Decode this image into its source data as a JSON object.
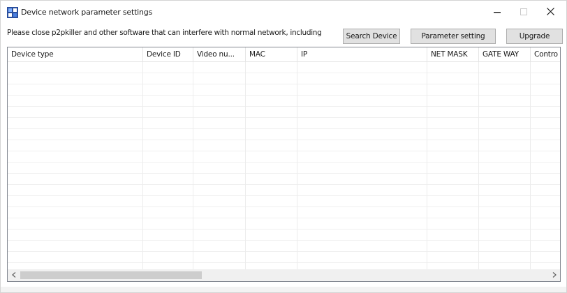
{
  "window": {
    "title": "Device network parameter settings",
    "icon": "app-grid-icon",
    "controls": {
      "minimize": "minimize-icon",
      "maximize": "maximize-icon",
      "close": "close-icon"
    }
  },
  "toolbar": {
    "notice": "Please close p2pkiller and other software that can interfere with normal network, including",
    "search_label": "Search Device",
    "parameter_label": "Parameter setting",
    "upgrade_label": "Upgrade"
  },
  "list": {
    "columns": [
      "Device type",
      "Device ID",
      "Video nu...",
      "MAC",
      "IP",
      "NET MASK",
      "GATE WAY",
      "Contro"
    ],
    "rows": []
  },
  "scrollbar": {
    "left_arrow": "chevron-left-icon",
    "right_arrow": "chevron-right-icon"
  }
}
